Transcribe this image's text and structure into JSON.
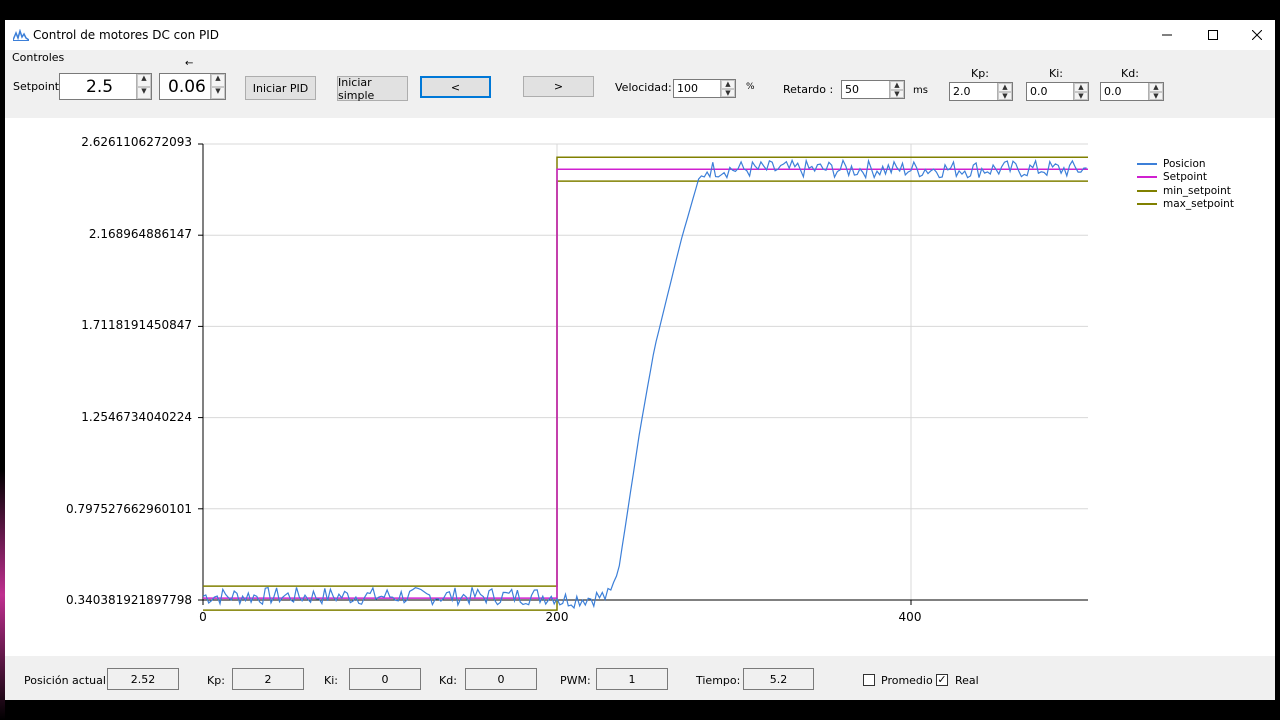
{
  "window": {
    "title": "Control de motores DC con PID",
    "minimize_icon": "minimize-icon",
    "maximize_icon": "maximize-icon",
    "close_icon": "close-icon"
  },
  "controls": {
    "group_label": "Controles",
    "setpoint_label": "Setpoint:",
    "setpoint_value": "2.5",
    "step_arrow": "←",
    "step_value": "0.06",
    "btn_iniciar_pid": "Iniciar PID",
    "btn_iniciar_simple": "Iniciar simple",
    "btn_left": "<",
    "btn_right": ">",
    "velocidad_label": "Velocidad:",
    "velocidad_value": "100",
    "velocidad_unit": "%",
    "retardo_label": "Retardo :",
    "retardo_value": "50",
    "retardo_unit": "ms",
    "kp_label": "Kp:",
    "kp_value": "2.0",
    "ki_label": "Ki:",
    "ki_value": "0.0",
    "kd_label": "Kd:",
    "kd_value": "0.0"
  },
  "chart_data": {
    "type": "line",
    "y_ticks": [
      "2.6261106272093",
      "2.168964886147",
      "1.7118191450847",
      "1.2546734040224",
      "0.797527662960101",
      "0.340381921897798"
    ],
    "x_ticks": [
      "0",
      "200",
      "400"
    ],
    "xlim": [
      0,
      500
    ],
    "ylim": [
      0.340381921897798,
      2.6261106272093
    ],
    "grid": true,
    "legend_position": "top-right",
    "series": [
      {
        "name": "Posicion",
        "color": "#3c7fd8",
        "x": [
          0,
          200,
          201,
          230,
          235,
          247,
          255,
          270,
          280,
          285,
          500
        ],
        "y": [
          0.36,
          0.36,
          0.34,
          0.36,
          0.5,
          1.2,
          1.6,
          2.14,
          2.45,
          2.5,
          2.5
        ]
      },
      {
        "name": "Setpoint",
        "color": "#d020d0",
        "x": [
          0,
          200,
          200,
          500
        ],
        "y": [
          0.35,
          0.35,
          2.5,
          2.5
        ]
      },
      {
        "name": "min_setpoint",
        "color": "#808000",
        "x": [
          0,
          200,
          200,
          500
        ],
        "y": [
          0.29,
          0.29,
          2.44,
          2.44
        ]
      },
      {
        "name": "max_setpoint",
        "color": "#808000",
        "x": [
          0,
          200,
          200,
          500
        ],
        "y": [
          0.41,
          0.41,
          2.56,
          2.56
        ]
      }
    ]
  },
  "status": {
    "posicion_label": "Posición actual:",
    "posicion_value": "2.52",
    "kp_label": "Kp:",
    "kp_value": "2",
    "ki_label": "Ki:",
    "ki_value": "0",
    "kd_label": "Kd:",
    "kd_value": "0",
    "pwm_label": "PWM:",
    "pwm_value": "1",
    "tiempo_label": "Tiempo:",
    "tiempo_value": "5.2",
    "promedio_label": "Promedio",
    "real_label": "Real",
    "real_checked": "✓"
  }
}
